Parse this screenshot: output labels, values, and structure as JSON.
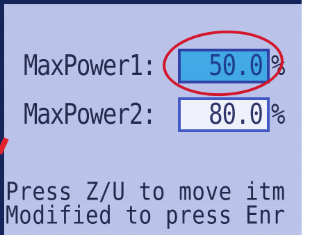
{
  "fields": [
    {
      "label": "MaxPower1:",
      "value": "50.0",
      "unit": "%",
      "selected": true
    },
    {
      "label": "MaxPower2:",
      "value": "80.0",
      "unit": "%",
      "selected": false
    }
  ],
  "hints": [
    "Press Z/U to move itm",
    "Modified to press Enr"
  ],
  "colors": {
    "screen_bg": "#b9c1e8",
    "selected_field": "#3ea7e5",
    "annotation": "#d3162a"
  }
}
